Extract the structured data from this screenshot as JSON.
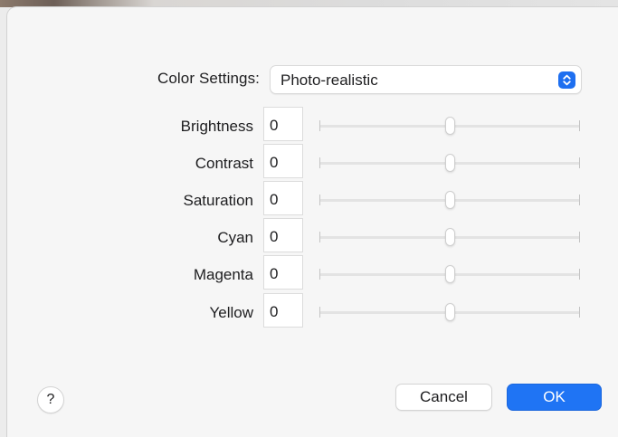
{
  "dialog": {
    "color_settings": {
      "label": "Color Settings:",
      "value": "Photo-realistic"
    },
    "adjustments": [
      {
        "label": "Brightness",
        "value": "0",
        "slider_level": 0.5
      },
      {
        "label": "Contrast",
        "value": "0",
        "slider_level": 0.5
      },
      {
        "label": "Saturation",
        "value": "0",
        "slider_level": 0.5
      },
      {
        "label": "Cyan",
        "value": "0",
        "slider_level": 0.5
      },
      {
        "label": "Magenta",
        "value": "0",
        "slider_level": 0.5
      },
      {
        "label": "Yellow",
        "value": "0",
        "slider_level": 0.5
      }
    ],
    "help_label": "?",
    "cancel_label": "Cancel",
    "ok_label": "OK"
  },
  "colors": {
    "accent": "#1f74f4",
    "background": "#f6f6f6"
  },
  "icons": [
    "up-down-chevron-icon",
    "help-icon"
  ]
}
